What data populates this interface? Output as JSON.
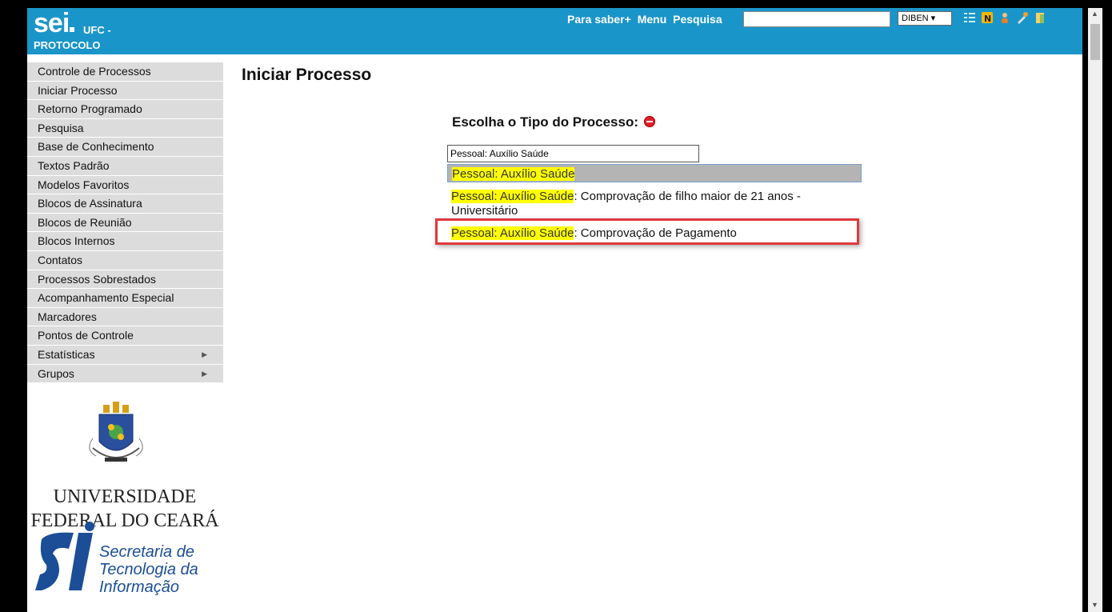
{
  "header": {
    "logo_text": "sei",
    "unit": "UFC -",
    "protocol": "PROTOCOLO",
    "links": [
      "Para saber+",
      "Menu",
      "Pesquisa"
    ],
    "search_value": "",
    "unit_select": "DIBEN ▾",
    "icons": [
      "list-icon",
      "notes-icon",
      "user-icon",
      "tools-icon",
      "exit-icon"
    ]
  },
  "sidebar": {
    "items": [
      {
        "label": "Controle de Processos"
      },
      {
        "label": "Iniciar Processo"
      },
      {
        "label": "Retorno Programado"
      },
      {
        "label": "Pesquisa"
      },
      {
        "label": "Base de Conhecimento"
      },
      {
        "label": "Textos Padrão"
      },
      {
        "label": "Modelos Favoritos"
      },
      {
        "label": "Blocos de Assinatura"
      },
      {
        "label": "Blocos de Reunião"
      },
      {
        "label": "Blocos Internos"
      },
      {
        "label": "Contatos"
      },
      {
        "label": "Processos Sobrestados"
      },
      {
        "label": "Acompanhamento Especial"
      },
      {
        "label": "Marcadores"
      },
      {
        "label": "Pontos de Controle"
      },
      {
        "label": "Estatísticas",
        "arrow": "▶"
      },
      {
        "label": "Grupos",
        "arrow": "▶"
      }
    ],
    "univ_line1": "UNIVERSIDADE",
    "univ_line2": "FEDERAL DO CEARÁ",
    "sti_line1": "Secretaria de",
    "sti_line2": "Tecnologia da",
    "sti_line3": "Informação"
  },
  "main": {
    "title": "Iniciar Processo",
    "subtitle": "Escolha o Tipo do Processo:",
    "filter_value": "Pessoal: Auxílio Saúde",
    "options": [
      {
        "highlight": "Pessoal: Auxílio Saúde",
        "rest": ""
      },
      {
        "highlight": "Pessoal: Auxílio Saúde",
        "rest": ": Comprovação de filho maior de 21 anos - Universitário"
      },
      {
        "highlight": "Pessoal: Auxílio Saúde",
        "rest": ": Comprovação de Pagamento"
      }
    ]
  },
  "colors": {
    "header_bg": "#1a95c9",
    "menu_bg": "#dcdcdc",
    "highlight": "#ffff00",
    "callout": "#e0393e"
  }
}
